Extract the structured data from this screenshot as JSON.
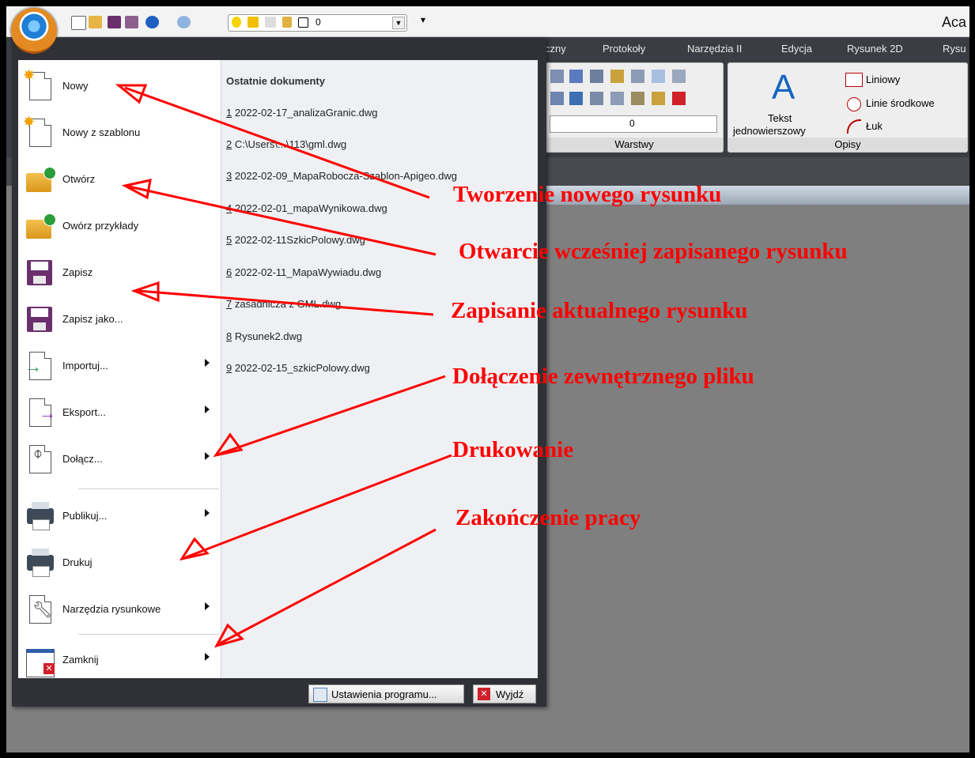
{
  "app": {
    "title": "Aca"
  },
  "quick_access": {
    "layer_value": "0",
    "more_symbol": "▾"
  },
  "ribbon": {
    "tabs": [
      "czny",
      "Protokoły",
      "Narzędzia II",
      "Edycja",
      "Rysunek 2D",
      "Rysu"
    ],
    "layers_group": {
      "label": "Warstwy",
      "layer_value": "0"
    },
    "text_group": {
      "big_letter": "A",
      "tekst_label_line1": "Tekst",
      "tekst_label_line2": "jednowierszowy",
      "items": [
        "Liniowy",
        "Linie środkowe",
        "Łuk"
      ],
      "footer": "Opisy"
    }
  },
  "app_menu": {
    "items": [
      {
        "label": "Nowy"
      },
      {
        "label": "Nowy z szablonu"
      },
      {
        "label": "Otwórz"
      },
      {
        "label": "Owórz przykłady"
      },
      {
        "label": "Zapisz"
      },
      {
        "label": "Zapisz jako..."
      },
      {
        "label": "Importuj..."
      },
      {
        "label": "Eksport..."
      },
      {
        "label": "Dołącz..."
      },
      {
        "label": "Publikuj..."
      },
      {
        "label": "Drukuj"
      },
      {
        "label": "Narzędzia rysunkowe"
      },
      {
        "label": "Zamknij"
      }
    ],
    "recent": {
      "header": "Ostatnie dokumenty",
      "files": [
        {
          "num": "1",
          "name": "2022-02-17_analizaGranic.dwg"
        },
        {
          "num": "2",
          "name": "C:\\Users\\...\\113\\gml.dwg"
        },
        {
          "num": "3",
          "name": "2022-02-09_MapaRobocza-Szablon-Apigeo.dwg"
        },
        {
          "num": "4",
          "name": "2022-02-01_mapaWynikowa.dwg"
        },
        {
          "num": "5",
          "name": "2022-02-11SzkicPolowy.dwg"
        },
        {
          "num": "6",
          "name": "2022-02-11_MapaWywiadu.dwg"
        },
        {
          "num": "7",
          "name": "zasadnicza z GML.dwg"
        },
        {
          "num": "8",
          "name": "Rysunek2.dwg"
        },
        {
          "num": "9",
          "name": "2022-02-15_szkicPolowy.dwg"
        }
      ]
    },
    "bottom": {
      "settings_label": "Ustawienia programu...",
      "exit_label": "Wyjdź"
    }
  },
  "annotations": [
    "Tworzenie nowego rysunku",
    "Otwarcie wcześniej zapisanego rysunku",
    "Zapisanie aktualnego rysunku",
    "Dołączenie zewnętrznego pliku",
    "Drukowanie",
    "Zakończenie pracy"
  ],
  "colors": {
    "annotation": "#ff0000",
    "menu_dark": "#2f3136",
    "ribbon_dark": "#3b3d44",
    "canvas": "#7f7f7f"
  }
}
